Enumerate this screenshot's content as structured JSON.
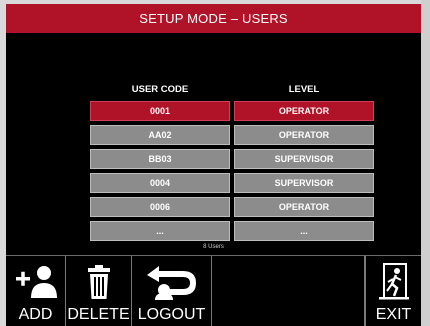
{
  "header": {
    "title": "SETUP MODE –  USERS"
  },
  "table": {
    "col_user": "USER CODE",
    "col_level": "LEVEL",
    "rows": [
      {
        "code": "0001",
        "level": "OPERATOR",
        "selected": true
      },
      {
        "code": "AA02",
        "level": "OPERATOR",
        "selected": false
      },
      {
        "code": "BB03",
        "level": "SUPERVISOR",
        "selected": false
      },
      {
        "code": "0004",
        "level": "SUPERVISOR",
        "selected": false
      },
      {
        "code": "0006",
        "level": "OPERATOR",
        "selected": false
      },
      {
        "code": "...",
        "level": "...",
        "selected": false
      }
    ],
    "count_label": "8 Users"
  },
  "toolbar": {
    "add": "ADD",
    "delete": "DELETE",
    "logout": "LOGOUT",
    "exit": "EXIT"
  },
  "colors": {
    "accent": "#b01228",
    "cell": "#8c8c8c",
    "background": "#000000"
  }
}
